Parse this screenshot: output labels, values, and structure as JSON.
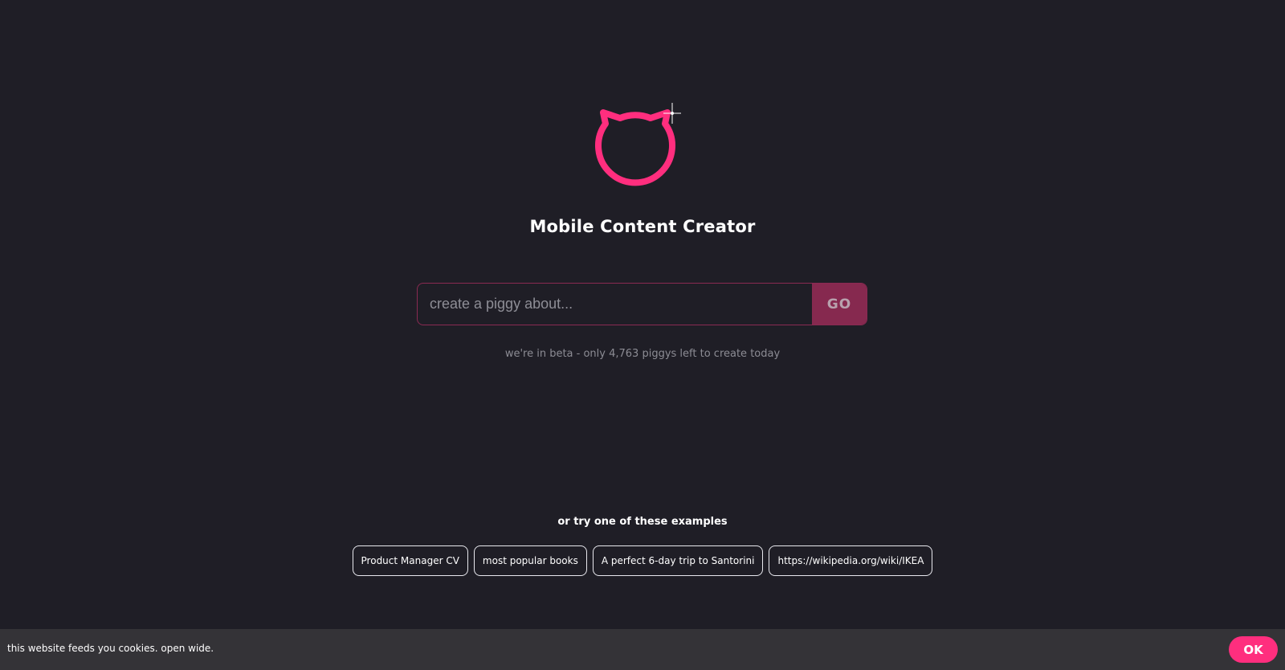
{
  "brand": {
    "logo_icon": "cat-head-outline-icon",
    "accent_color": "#ff2e7e",
    "title": "Mobile Content Creator"
  },
  "search": {
    "placeholder": "create a piggy about...",
    "value": "",
    "go_label": "GO"
  },
  "beta_notice": "we're in beta - only 4,763 piggys left to create today",
  "examples": {
    "heading": "or try one of these examples",
    "items": [
      "Product Manager CV",
      "most popular books",
      "A perfect 6-day trip to Santorini",
      "https://wikipedia.org/wiki/IKEA"
    ]
  },
  "cookie_banner": {
    "text": "this website feeds you cookies. open wide.",
    "ok_label": "OK"
  }
}
